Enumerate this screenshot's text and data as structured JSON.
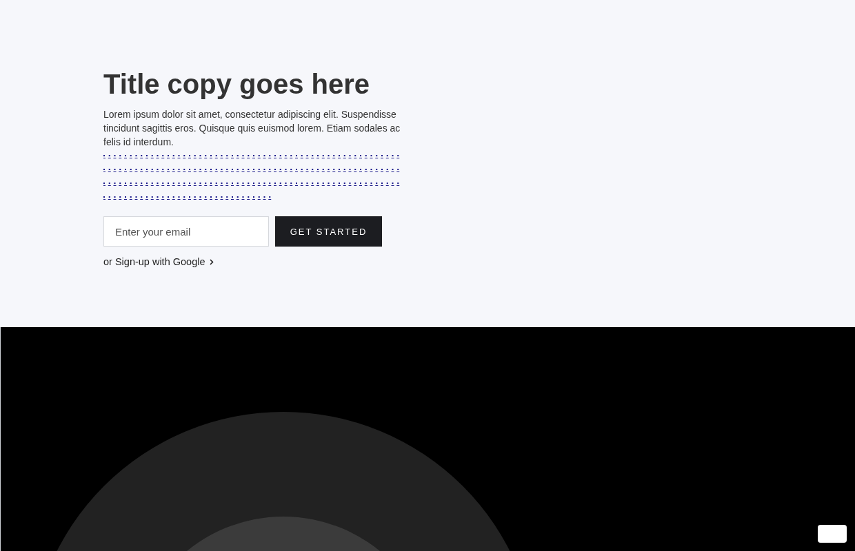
{
  "hero": {
    "title": "Title copy goes here",
    "body": "Lorem ipsum dolor sit amet, consectetur adipiscing elit. Suspendisse tincidunt sagittis eros. Quisque quis euismod lorem. Etiam sodales ac felis id interdum.",
    "email": {
      "placeholder": "Enter your email"
    },
    "cta": "GET STARTED",
    "google_link": "or Sign-up with Google"
  }
}
